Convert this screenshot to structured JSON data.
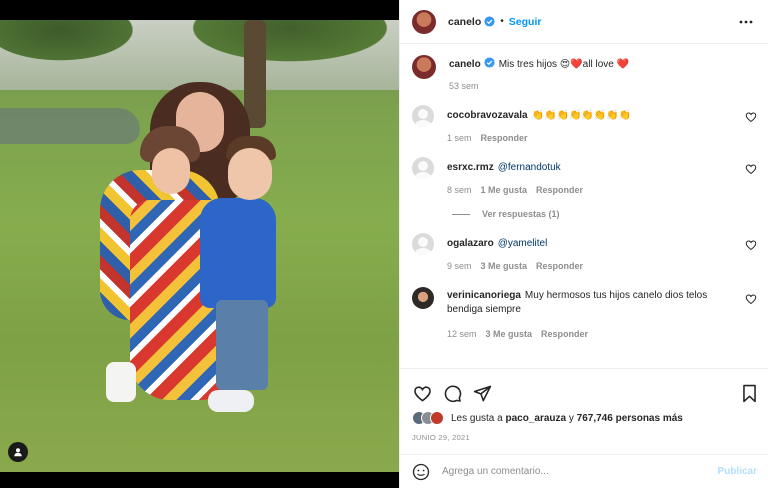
{
  "header": {
    "username": "canelo",
    "separator": "•",
    "follow_label": "Seguir"
  },
  "caption": {
    "username": "canelo",
    "text": "Mis tres hijos 😍❤️all love ❤️",
    "time": "53 sem"
  },
  "comments": [
    {
      "username": "cocobravozavala",
      "text": "👏👏👏👏👏👏👏👏",
      "time": "1 sem",
      "likes": "",
      "reply_label": "Responder",
      "avatar": "default"
    },
    {
      "username": "esrxc.rmz",
      "text": "@fernandotuk",
      "time": "8 sem",
      "likes": "1 Me gusta",
      "reply_label": "Responder",
      "avatar": "default",
      "replies_label": "Ver respuestas (1)"
    },
    {
      "username": "ogalazaro",
      "text": "@yamelitel",
      "time": "9 sem",
      "likes": "3 Me gusta",
      "reply_label": "Responder",
      "avatar": "default"
    },
    {
      "username": "verinicanoriega",
      "text": "Muy hermosos tus hijos canelo dios telos bendiga siempre",
      "time": "12 sem",
      "likes": "3 Me gusta",
      "reply_label": "Responder",
      "avatar": "photo"
    }
  ],
  "likes": {
    "prefix": "Les gusta a",
    "user": "paco_arauza",
    "connector": "y",
    "count": "767,746 personas más"
  },
  "date": "JUNIO 29, 2021",
  "add_comment": {
    "placeholder": "Agrega un comentario...",
    "post_label": "Publicar"
  },
  "colors": {
    "link_blue": "#0095f6",
    "mention_blue": "#00376b",
    "muted": "#8e8e8e",
    "border": "#efefef",
    "publish_disabled": "#b2dffc"
  },
  "icons": [
    "user-tag-icon",
    "verified-icon",
    "more-icon",
    "heart-icon",
    "comment-icon",
    "share-icon",
    "bookmark-icon",
    "emoji-icon"
  ]
}
